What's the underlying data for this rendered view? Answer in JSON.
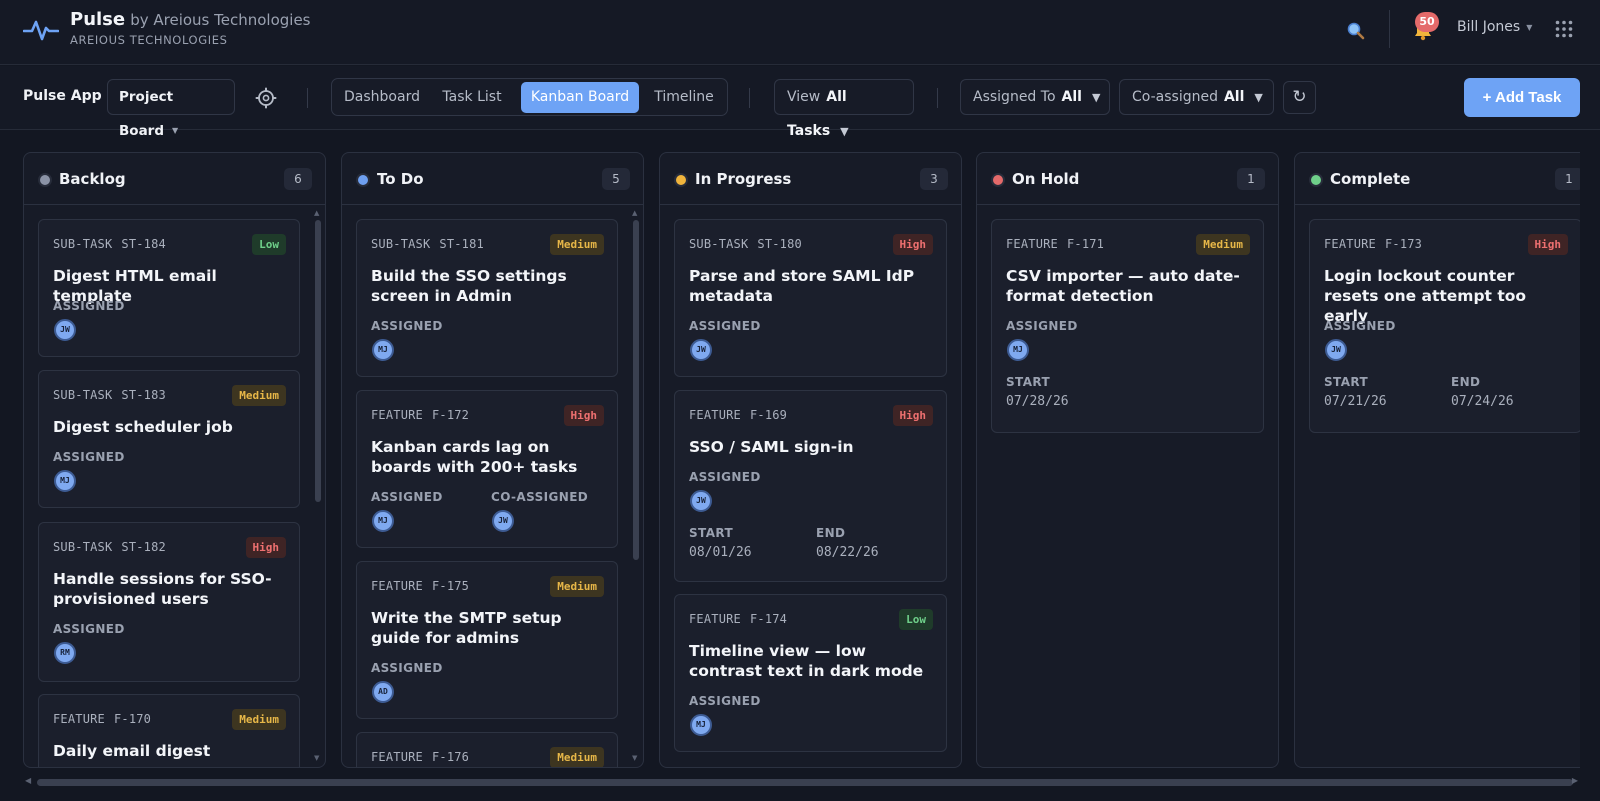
{
  "header": {
    "brand_name": "Pulse",
    "brand_by": "by Areious Technologies",
    "brand_sub": "AREIOUS TECHNOLOGIES",
    "notifications_count": "50",
    "user_name": "Bill Jones",
    "icons": [
      "pulse-logo-icon",
      "search-icon",
      "bell-icon",
      "apps-grid-icon"
    ]
  },
  "toolbar": {
    "app_label": "Pulse App",
    "project_select": "Project Board",
    "tabs": [
      {
        "label": "Dashboard",
        "active": false
      },
      {
        "label": "Task List",
        "active": false
      },
      {
        "label": "Kanban Board",
        "active": true
      },
      {
        "label": "Timeline",
        "active": false
      }
    ],
    "view_label": "View",
    "view_value": "All Tasks",
    "assigned_label": "Assigned To",
    "assigned_value": "All",
    "coassigned_label": "Co-assigned",
    "coassigned_value": "All",
    "add_task_label": "+ Add Task"
  },
  "colors": {
    "accent": "#6ea3f5",
    "backlog": "#8b93a6",
    "todo": "#6e9ff0",
    "in_progress": "#f0b43c",
    "on_hold": "#e46a6a",
    "complete": "#6fd08a"
  },
  "columns": [
    {
      "title": "Backlog",
      "count": "6",
      "cards": [
        {
          "type": "SUB-TASK",
          "id": "ST-184",
          "priority": "Low",
          "title": "Digest HTML email template",
          "assigned_label": "ASSIGNED",
          "assigned": "JW"
        },
        {
          "type": "SUB-TASK",
          "id": "ST-183",
          "priority": "Medium",
          "title": "Digest scheduler job",
          "assigned_label": "ASSIGNED",
          "assigned": "MJ"
        },
        {
          "type": "SUB-TASK",
          "id": "ST-182",
          "priority": "High",
          "title": "Handle sessions for SSO-provisioned users",
          "assigned_label": "ASSIGNED",
          "assigned": "RM"
        },
        {
          "type": "FEATURE",
          "id": "F-170",
          "priority": "Medium",
          "title": "Daily email digest"
        }
      ]
    },
    {
      "title": "To Do",
      "count": "5",
      "cards": [
        {
          "type": "SUB-TASK",
          "id": "ST-181",
          "priority": "Medium",
          "title": "Build the SSO settings screen in Admin",
          "assigned_label": "ASSIGNED",
          "assigned": "MJ"
        },
        {
          "type": "FEATURE",
          "id": "F-172",
          "priority": "High",
          "title": "Kanban cards lag on boards with 200+ tasks",
          "assigned_label": "ASSIGNED",
          "assigned": "MJ",
          "coassigned_label": "CO-ASSIGNED",
          "coassigned": "JW"
        },
        {
          "type": "FEATURE",
          "id": "F-175",
          "priority": "Medium",
          "title": "Write the SMTP setup guide for admins",
          "assigned_label": "ASSIGNED",
          "assigned": "AD"
        },
        {
          "type": "FEATURE",
          "id": "F-176",
          "priority": "Medium"
        }
      ]
    },
    {
      "title": "In Progress",
      "count": "3",
      "cards": [
        {
          "type": "SUB-TASK",
          "id": "ST-180",
          "priority": "High",
          "title": "Parse and store SAML IdP metadata",
          "assigned_label": "ASSIGNED",
          "assigned": "JW"
        },
        {
          "type": "FEATURE",
          "id": "F-169",
          "priority": "High",
          "title": "SSO / SAML sign-in",
          "assigned_label": "ASSIGNED",
          "assigned": "JW",
          "start_label": "START",
          "start": "08/01/26",
          "end_label": "END",
          "end": "08/22/26"
        },
        {
          "type": "FEATURE",
          "id": "F-174",
          "priority": "Low",
          "title": "Timeline view — low contrast text in dark mode",
          "assigned_label": "ASSIGNED",
          "assigned": "MJ"
        }
      ]
    },
    {
      "title": "On Hold",
      "count": "1",
      "cards": [
        {
          "type": "FEATURE",
          "id": "F-171",
          "priority": "Medium",
          "title": "CSV importer — auto date-format detection",
          "assigned_label": "ASSIGNED",
          "assigned": "MJ",
          "start_label": "START",
          "start": "07/28/26"
        }
      ]
    },
    {
      "title": "Complete",
      "count": "1",
      "cards": [
        {
          "type": "FEATURE",
          "id": "F-173",
          "priority": "High",
          "title": "Login lockout counter resets one attempt too early",
          "assigned_label": "ASSIGNED",
          "assigned": "JW",
          "start_label": "START",
          "start": "07/21/26",
          "end_label": "END",
          "end": "07/24/26"
        }
      ]
    }
  ]
}
